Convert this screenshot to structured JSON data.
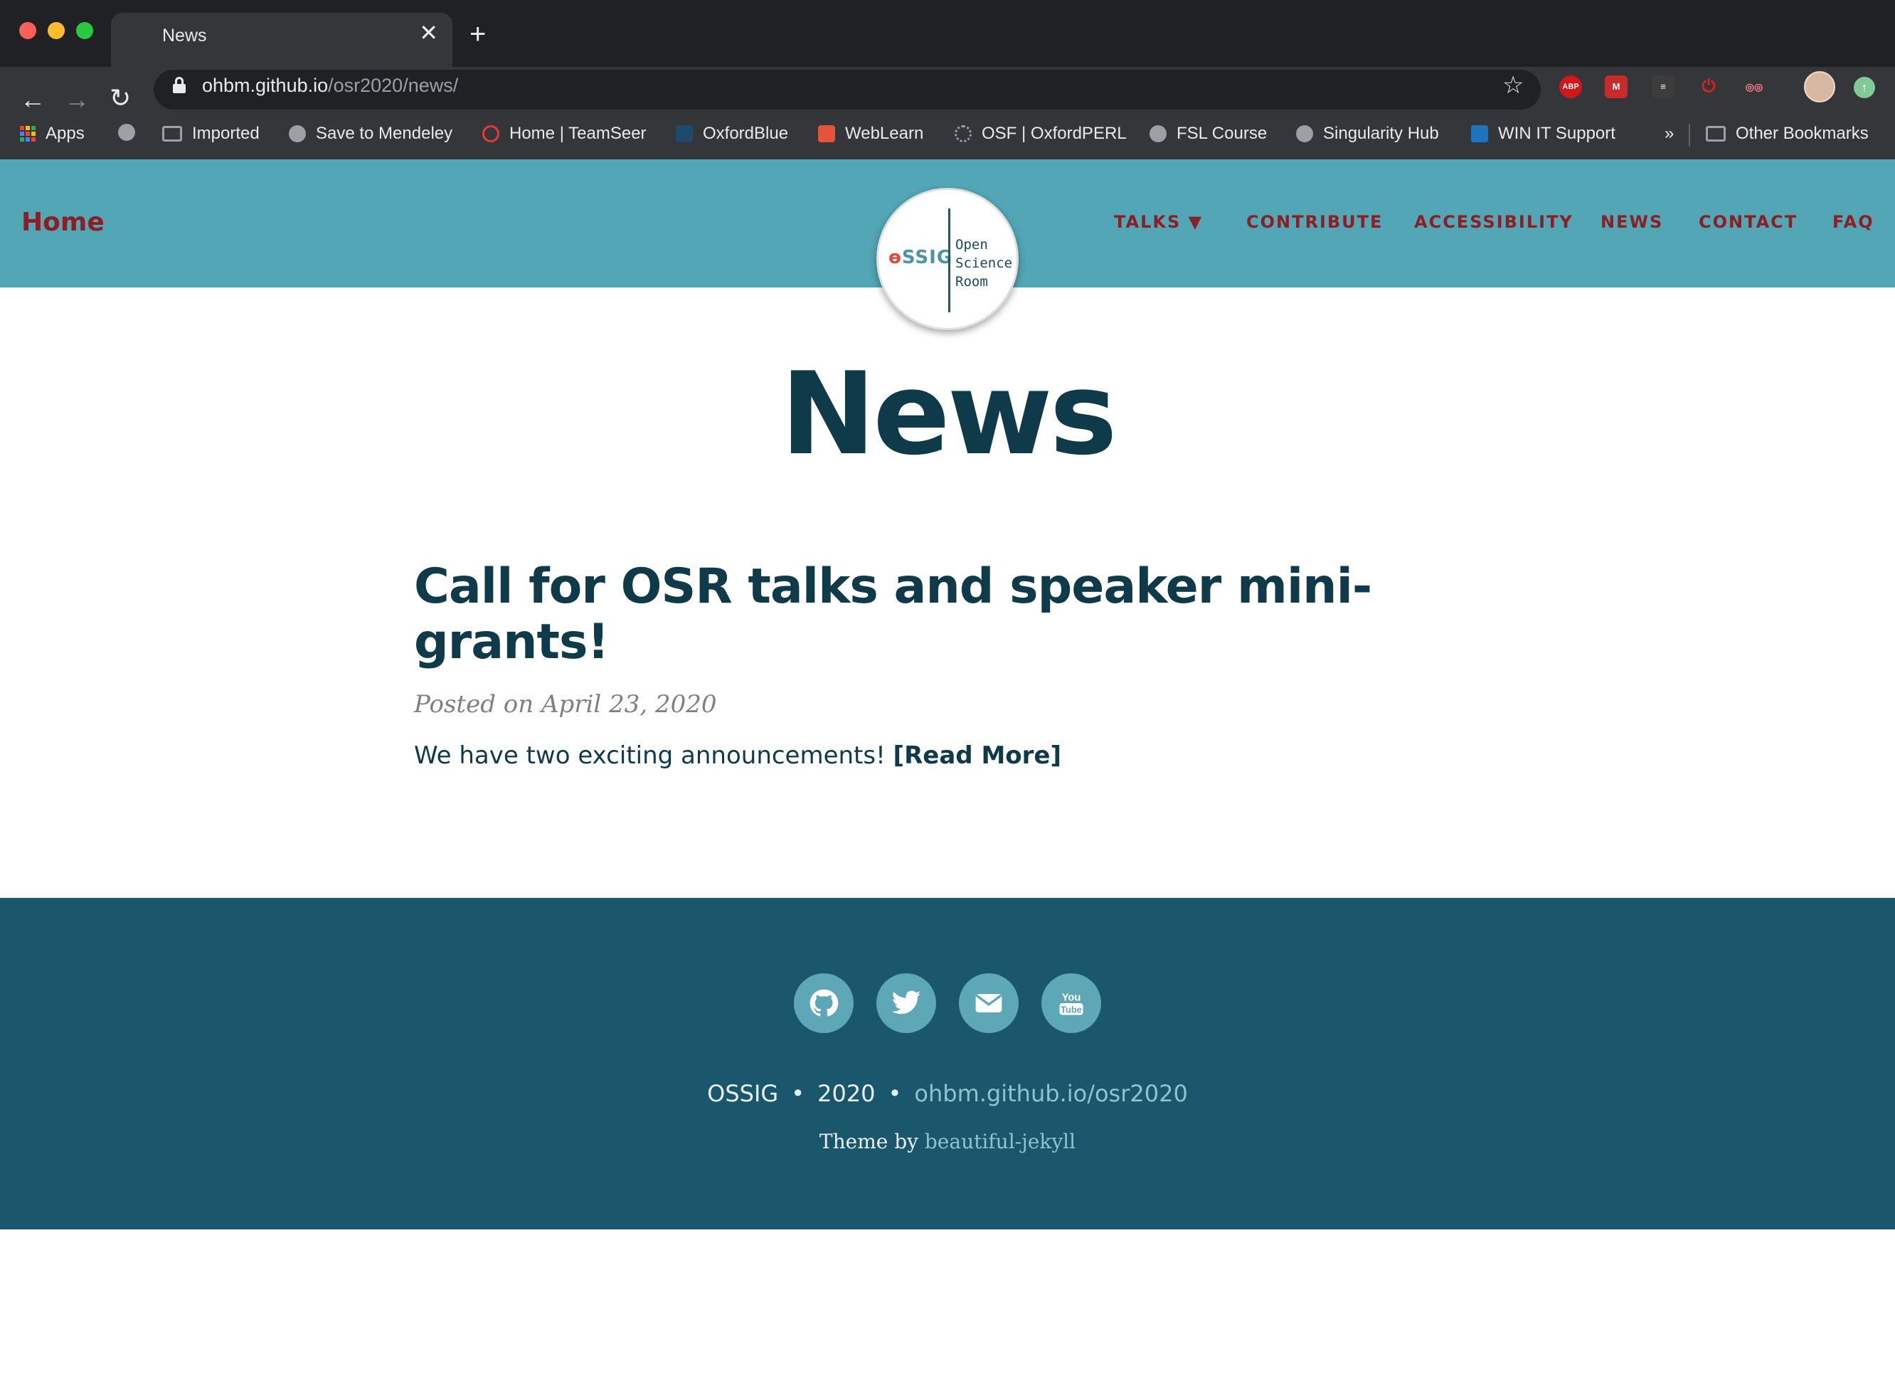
{
  "browser": {
    "tab_title": "News",
    "tab_close": "✕",
    "new_tab": "+",
    "url_host": "ohbm.github.io",
    "url_path": "/osr2020/news/",
    "bookmarks": [
      {
        "label": "Apps",
        "icon": "apps-grid-icon"
      },
      {
        "label": "",
        "icon": "globe-icon"
      },
      {
        "label": "Imported",
        "icon": "folder-icon"
      },
      {
        "label": "Save to Mendeley",
        "icon": "globe-icon"
      },
      {
        "label": "Home | TeamSeer",
        "icon": "teamseer-icon"
      },
      {
        "label": "OxfordBlue",
        "icon": "shield-icon"
      },
      {
        "label": "WebLearn",
        "icon": "weblearn-icon"
      },
      {
        "label": "OSF | OxfordPERL",
        "icon": "gear-icon"
      },
      {
        "label": "FSL Course",
        "icon": "globe-icon"
      },
      {
        "label": "Singularity Hub",
        "icon": "globe-icon"
      },
      {
        "label": "WIN IT Support",
        "icon": "sharepoint-icon"
      }
    ],
    "bookmarks_overflow": "»",
    "other_bookmarks": "Other Bookmarks",
    "extensions": [
      {
        "name": "adblock-plus-icon",
        "label": "ABP",
        "color": "#d0171c"
      },
      {
        "name": "mendeley-icon",
        "label": "M",
        "color": "#c92a2a"
      },
      {
        "name": "document-icon",
        "label": "≡",
        "color": "#3c3c3c"
      },
      {
        "name": "power-icon",
        "label": "⏻",
        "color": "#e02020"
      },
      {
        "name": "eyes-icon",
        "label": "◎◎",
        "color": "#2b6cb0"
      }
    ]
  },
  "site": {
    "brand": "Home",
    "logo": {
      "ossig_o": "ɵ",
      "ossig_rest": "SSIG",
      "lines": [
        "Open",
        "Science",
        "Room"
      ]
    },
    "nav": [
      {
        "label": "TALKS ▼"
      },
      {
        "label": "CONTRIBUTE"
      },
      {
        "label": "ACCESSIBILITY"
      },
      {
        "label": "NEWS"
      },
      {
        "label": "CONTACT"
      },
      {
        "label": "FAQ"
      }
    ],
    "colors": {
      "navbar": "#52a6b5",
      "nav_text": "#8c1e24",
      "heading": "#0f3a4a",
      "footer": "#1a566c"
    }
  },
  "page": {
    "title": "News",
    "post": {
      "title": "Call for OSR talks and speaker mini-grants!",
      "meta": "Posted on April 23, 2020",
      "excerpt": "We have two exciting announcements!",
      "read_more": "[Read More]"
    }
  },
  "footer": {
    "social": [
      "github-icon",
      "twitter-icon",
      "email-icon",
      "youtube-icon"
    ],
    "org": "OSSIG",
    "year": "2020",
    "separator": "•",
    "site_url": "ohbm.github.io/osr2020",
    "theme_prefix": "Theme by",
    "theme_link": "beautiful-jekyll"
  }
}
